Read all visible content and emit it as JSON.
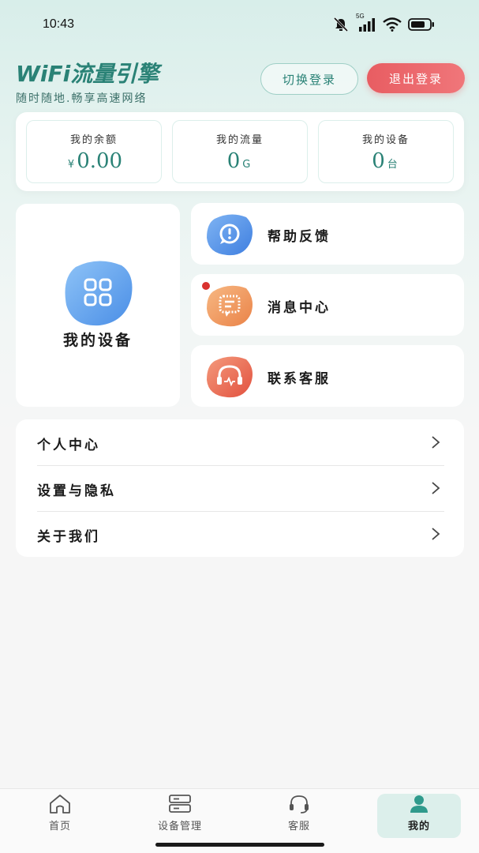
{
  "status": {
    "time": "10:43",
    "network": "5G"
  },
  "brand": {
    "title": "WiFi流量引擎",
    "subtitle": "随时随地.畅享高速网络"
  },
  "header": {
    "switch_label": "切换登录",
    "logout_label": "退出登录"
  },
  "stats": [
    {
      "label": "我的余额",
      "prefix": "¥",
      "value": "0.00",
      "unit": ""
    },
    {
      "label": "我的流量",
      "prefix": "",
      "value": "0",
      "unit": "G"
    },
    {
      "label": "我的设备",
      "prefix": "",
      "value": "0",
      "unit": "台"
    }
  ],
  "device_card": {
    "label": "我的设备",
    "icon": "apps-grid-icon"
  },
  "menu": [
    {
      "label": "帮助反馈",
      "icon": "help-feedback-icon",
      "color": "#4f8de8",
      "badge": false
    },
    {
      "label": "消息中心",
      "icon": "message-icon",
      "color": "#f0955b",
      "badge": true
    },
    {
      "label": "联系客服",
      "icon": "headset-icon",
      "color": "#ec6b5a",
      "badge": false
    }
  ],
  "list": [
    {
      "label": "个人中心"
    },
    {
      "label": "设置与隐私"
    },
    {
      "label": "关于我们"
    }
  ],
  "tabbar": [
    {
      "label": "首页",
      "icon": "home-icon",
      "active": false
    },
    {
      "label": "设备管理",
      "icon": "server-icon",
      "active": false
    },
    {
      "label": "客服",
      "icon": "headset-icon",
      "active": false
    },
    {
      "label": "我的",
      "icon": "user-icon",
      "active": true
    }
  ],
  "colors": {
    "accent": "#2a8276",
    "logout": "#e85d62",
    "active_tab_bg": "#dcefeb"
  }
}
